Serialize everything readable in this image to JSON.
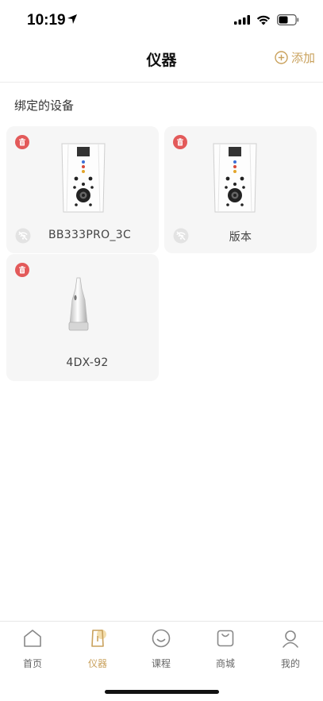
{
  "status_bar": {
    "time": "10:19"
  },
  "nav": {
    "title": "仪器",
    "add_label": "添加"
  },
  "section": {
    "title": "绑定的设备"
  },
  "devices": [
    {
      "name": "BB333PRO_3C",
      "icon": "tower-device-icon"
    },
    {
      "name": "版本",
      "icon": "tower-device-icon"
    },
    {
      "name": "4DX-92",
      "icon": "handheld-device-icon"
    }
  ],
  "tabs": [
    {
      "label": "首页",
      "icon": "home-icon",
      "active": false
    },
    {
      "label": "仪器",
      "icon": "instrument-icon",
      "active": true
    },
    {
      "label": "课程",
      "icon": "smile-icon",
      "active": false
    },
    {
      "label": "商城",
      "icon": "bag-icon",
      "active": false
    },
    {
      "label": "我的",
      "icon": "user-icon",
      "active": false
    }
  ],
  "colors": {
    "accent": "#c9a15c",
    "delete": "#e35a5a",
    "card_bg": "#f6f6f6"
  }
}
